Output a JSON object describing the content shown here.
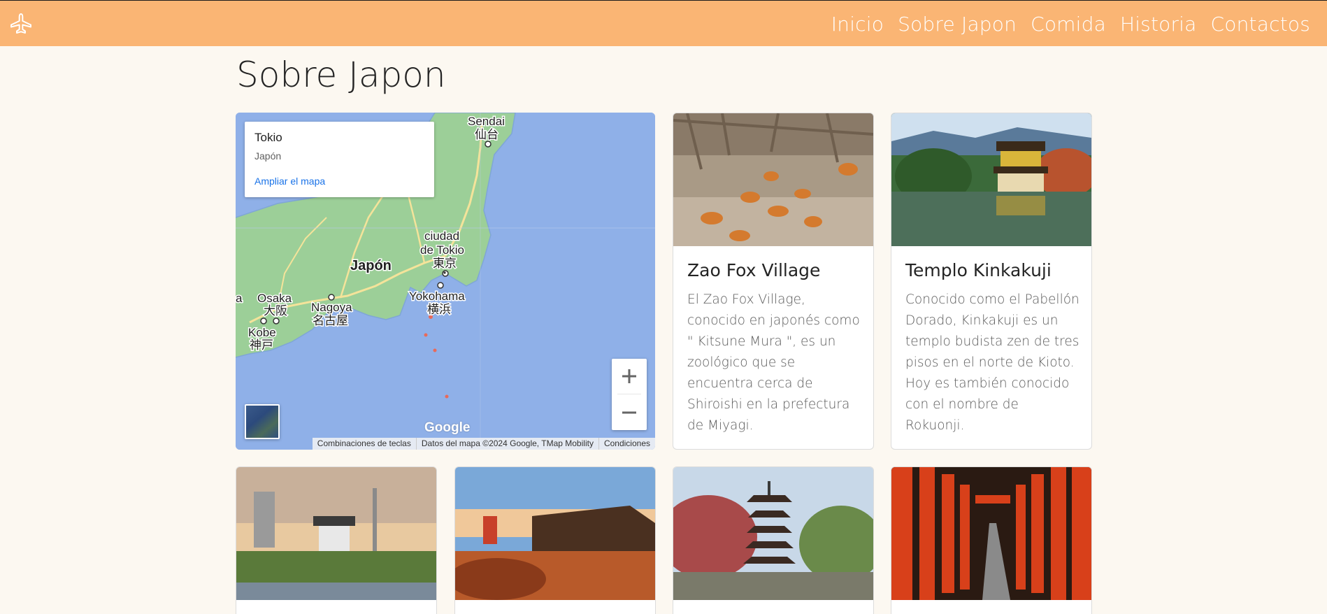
{
  "nav": {
    "logo_icon": "airplane-icon",
    "links": [
      "Inicio",
      "Sobre Japon",
      "Comida",
      "Historia",
      "Contactos"
    ]
  },
  "page": {
    "title": "Sobre Japon"
  },
  "map": {
    "place": "Tokio",
    "country": "Japón",
    "enlarge_link": "Ampliar el mapa",
    "zoom_in": "+",
    "zoom_out": "−",
    "google_logo": "Google",
    "labels": {
      "sendai": "Sendai",
      "sendai_jp": "仙台",
      "tokio_1": "ciudad",
      "tokio_2": "de Tokio",
      "tokio_jp": "東京",
      "japon": "Japón",
      "osaka": "Osaka",
      "osaka_jp": "大阪",
      "nagoya": "Nagoya",
      "nagoya_jp": "名古屋",
      "yokohama": "Yokohama",
      "yokohama_jp": "横浜",
      "kobe": "Kobe",
      "kobe_jp": "神戸",
      "edge": "a"
    },
    "attribution": {
      "shortcuts": "Combinaciones de teclas",
      "data": "Datos del mapa ©2024 Google, TMap Mobility",
      "terms": "Condiciones"
    }
  },
  "cards": [
    {
      "title": "Zao Fox Village",
      "text": "El Zao Fox Village, conocido en japonés como \" Kitsune Mura \", es un zoológico que se encuentra cerca de Shiroishi en la prefectura de Miyagi."
    },
    {
      "title": "Templo Kinkakuji",
      "text": "Conocido como el Pabellón Dorado, Kinkakuji es un templo budista zen de tres pisos en el norte de Kioto. Hoy es también conocido con el nombre de Rokuonji."
    },
    {
      "title": "",
      "text": ""
    },
    {
      "title": "",
      "text": ""
    },
    {
      "title": "",
      "text": ""
    },
    {
      "title": "",
      "text": ""
    }
  ]
}
